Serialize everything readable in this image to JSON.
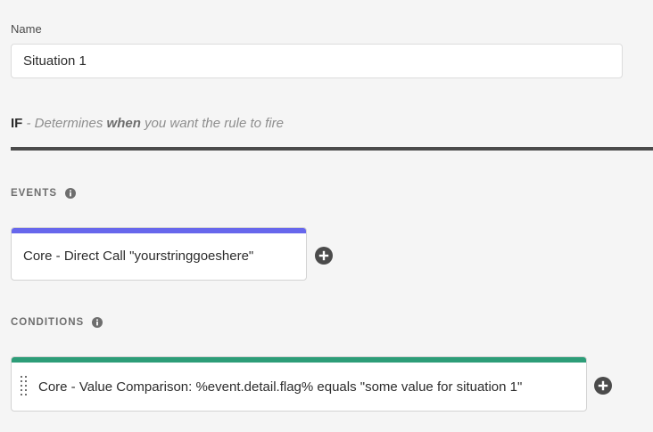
{
  "name_field": {
    "label": "Name",
    "value": "Situation 1"
  },
  "if_section": {
    "keyword": "IF",
    "desc_prefix": " - Determines ",
    "desc_emphasis": "when",
    "desc_suffix": " you want the rule to fire"
  },
  "events": {
    "heading": "EVENTS",
    "info_icon": "info-circle-icon",
    "card": {
      "text": "Core - Direct Call \"yourstringgoeshere\"",
      "accent_color": "#6767ec"
    },
    "add_icon": "plus-circle-icon"
  },
  "conditions": {
    "heading": "CONDITIONS",
    "info_icon": "info-circle-icon",
    "card": {
      "text": "Core - Value Comparison: %event.detail.flag% equals \"some value for situation 1\"",
      "accent_color": "#2d9d78",
      "handle_icon": "drag-handle-icon"
    },
    "add_icon": "plus-circle-icon"
  }
}
